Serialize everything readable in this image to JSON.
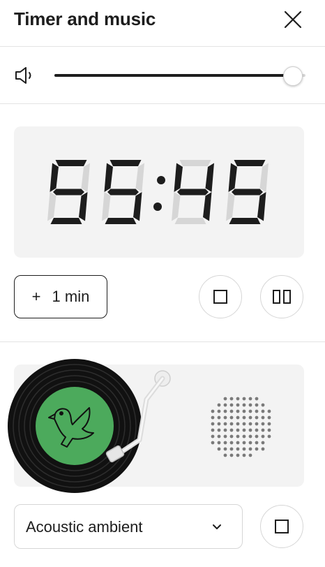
{
  "header": {
    "title": "Timer and music"
  },
  "volume": {
    "level_percent": 95
  },
  "timer": {
    "display": "55:45",
    "add_label": "+",
    "add_amount": "1 min"
  },
  "music": {
    "selected_track": "Acoustic ambient"
  },
  "icons": {
    "close": "close-icon",
    "speaker": "speaker-icon",
    "stop": "stop-icon",
    "pause": "pause-icon",
    "chevron": "chevron-down-icon",
    "turntable": "turntable-illustration",
    "bird": "bird-icon"
  },
  "colors": {
    "text": "#1d1d1d",
    "panel": "#f3f3f3",
    "record_label": "#4caa5c",
    "segment_off": "#d6d6d6"
  }
}
